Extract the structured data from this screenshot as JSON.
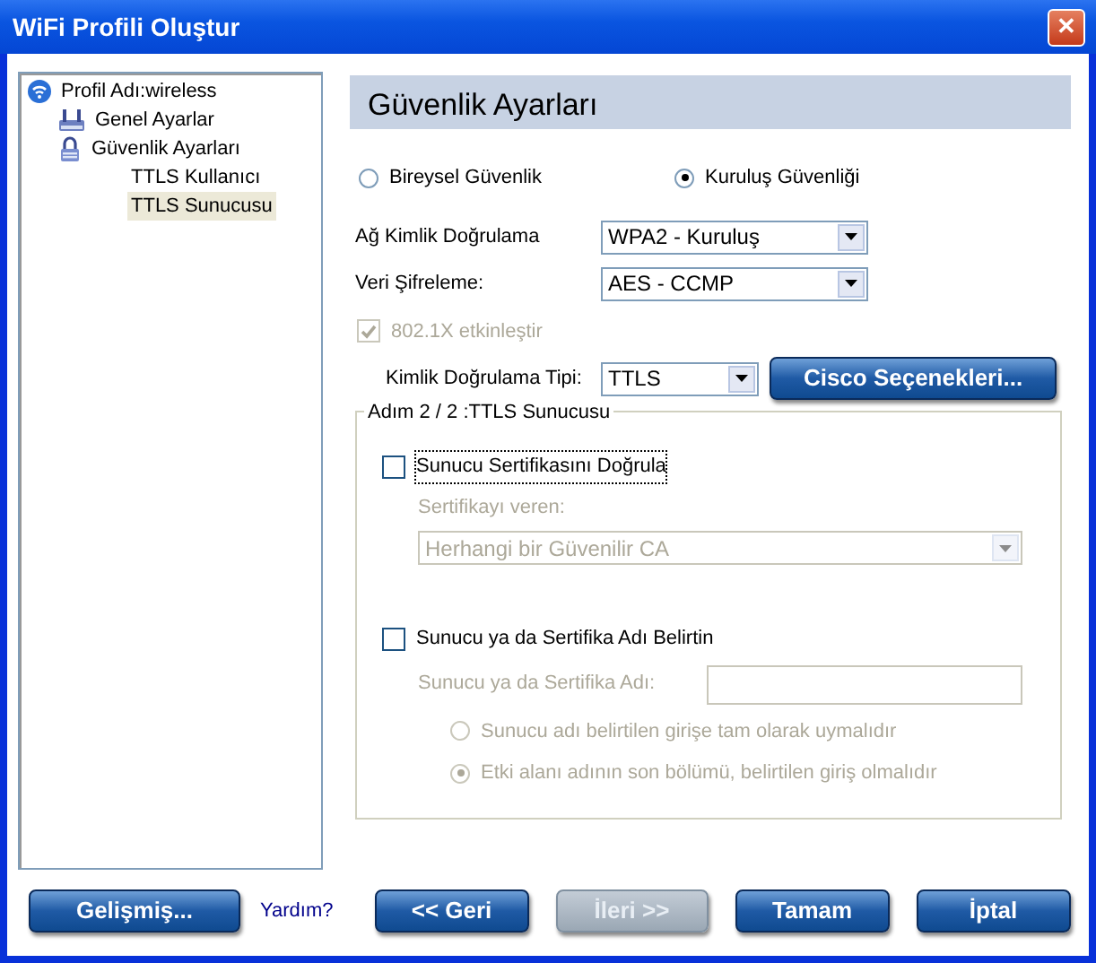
{
  "window": {
    "title": "WiFi Profili Oluştur",
    "close_label": "✕"
  },
  "tree": [
    {
      "label": "Profil Adı:wireless",
      "selected": false,
      "children": [
        {
          "label": "Genel Ayarlar",
          "selected": false
        },
        {
          "label": "Güvenlik Ayarları",
          "selected": false,
          "children": [
            {
              "label": "TTLS Kullanıcı",
              "selected": false
            },
            {
              "label": "TTLS Sunucusu",
              "selected": true
            }
          ]
        }
      ]
    }
  ],
  "header": "Güvenlik Ayarları",
  "security_modes": [
    {
      "label": "Bireysel Güvenlik",
      "selected": false
    },
    {
      "label": "Kuruluş Güvenliği",
      "selected": true
    }
  ],
  "selects": [
    {
      "label": "Ağ Kimlik Doğrulama",
      "value": "WPA2 - Kuruluş"
    },
    {
      "label": "Veri Şifreleme:",
      "value": "AES - CCMP"
    }
  ],
  "enable_8021x": {
    "label": "802.1X etkinleştir",
    "checked": true,
    "disabled": true
  },
  "auth_type": {
    "label": "Kimlik Doğrulama Tipi:",
    "value": "TTLS"
  },
  "cisco_button": "Cisco Seçenekleri...",
  "group": {
    "title": "Adım 2 / 2 :TTLS Sunucusu",
    "verify_cert": {
      "label": "Sunucu Sertifikasını Doğrula",
      "checked": false
    },
    "issuer_label": "Sertifikayı veren:",
    "issuer_value": "Herhangi bir Güvenilir CA",
    "issuer_disabled": true,
    "specify_name": {
      "label": "Sunucu ya da Sertifika Adı Belirtin",
      "checked": false
    },
    "name_label": "Sunucu ya da Sertifika Adı:",
    "name_disabled": true,
    "match_options": [
      {
        "label": "Sunucu adı belirtilen girişe tam olarak uymalıdır",
        "selected": false,
        "disabled": true
      },
      {
        "label": "Etki alanı adının son bölümü, belirtilen giriş olmalıdır",
        "selected": true,
        "disabled": true
      }
    ]
  },
  "footer": [
    {
      "kind": "button",
      "label": "Gelişmiş...",
      "disabled": false
    },
    {
      "kind": "link",
      "label": "Yardım?"
    },
    {
      "kind": "button",
      "label": "<< Geri",
      "disabled": false
    },
    {
      "kind": "button",
      "label": "İleri >>",
      "disabled": true
    },
    {
      "kind": "button",
      "label": "Tamam",
      "disabled": false
    },
    {
      "kind": "button",
      "label": "İptal",
      "disabled": false
    }
  ]
}
